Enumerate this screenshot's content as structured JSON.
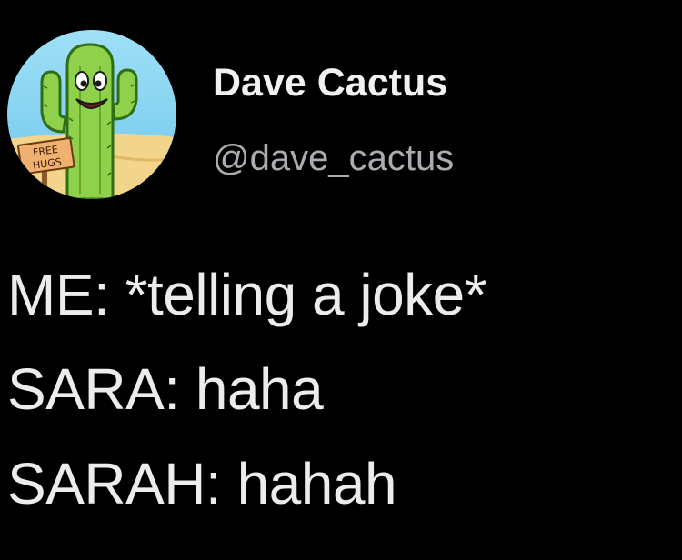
{
  "author": {
    "display_name": "Dave Cactus",
    "handle": "@dave_cactus",
    "avatar": {
      "icon": "cactus-icon",
      "sign_text": [
        "FREE",
        "HUGS"
      ],
      "colors": {
        "sky": "#7fd2f0",
        "ground": "#f2d58a",
        "cactus": "#8fd14a",
        "cactus_dark": "#3f8a1e",
        "sign": "#e9a15a"
      }
    }
  },
  "tweet": {
    "lines": [
      "ME: *telling a joke*",
      "SARA: haha",
      "SARAH: hahah"
    ]
  },
  "colors": {
    "background": "#000000",
    "name": "#f1f1f1",
    "handle": "#a9acb0",
    "text": "#ececec"
  }
}
